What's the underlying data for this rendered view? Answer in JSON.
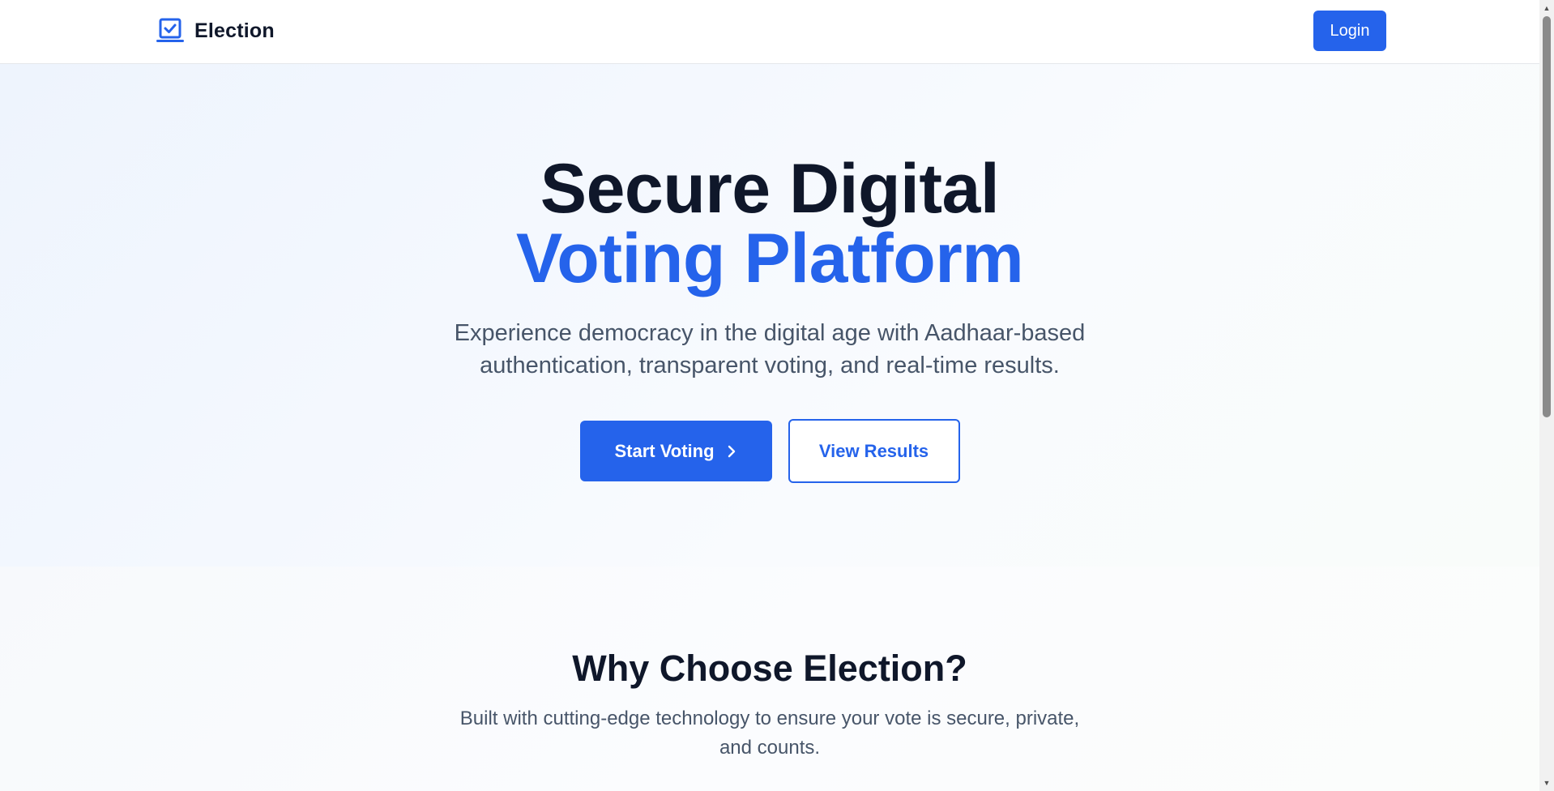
{
  "header": {
    "brand_name": "Election",
    "brand_icon": "vote-laptop-check-icon",
    "login_label": "Login"
  },
  "hero": {
    "title_line1": "Secure Digital",
    "title_line2": "Voting Platform",
    "subtitle_line1": "Experience democracy in the digital age with Aadhaar-based",
    "subtitle_line2": "authentication, transparent voting, and real-time results.",
    "primary_button": "Start Voting",
    "primary_button_icon": "chevron-right-icon",
    "secondary_button": "View Results"
  },
  "features": {
    "title": "Why Choose Election?",
    "subtitle_line1": "Built with cutting-edge technology to ensure your vote is secure, private,",
    "subtitle_line2": "and counts."
  },
  "colors": {
    "accent": "#2563eb",
    "heading": "#0f172a",
    "body_text": "#475569"
  }
}
